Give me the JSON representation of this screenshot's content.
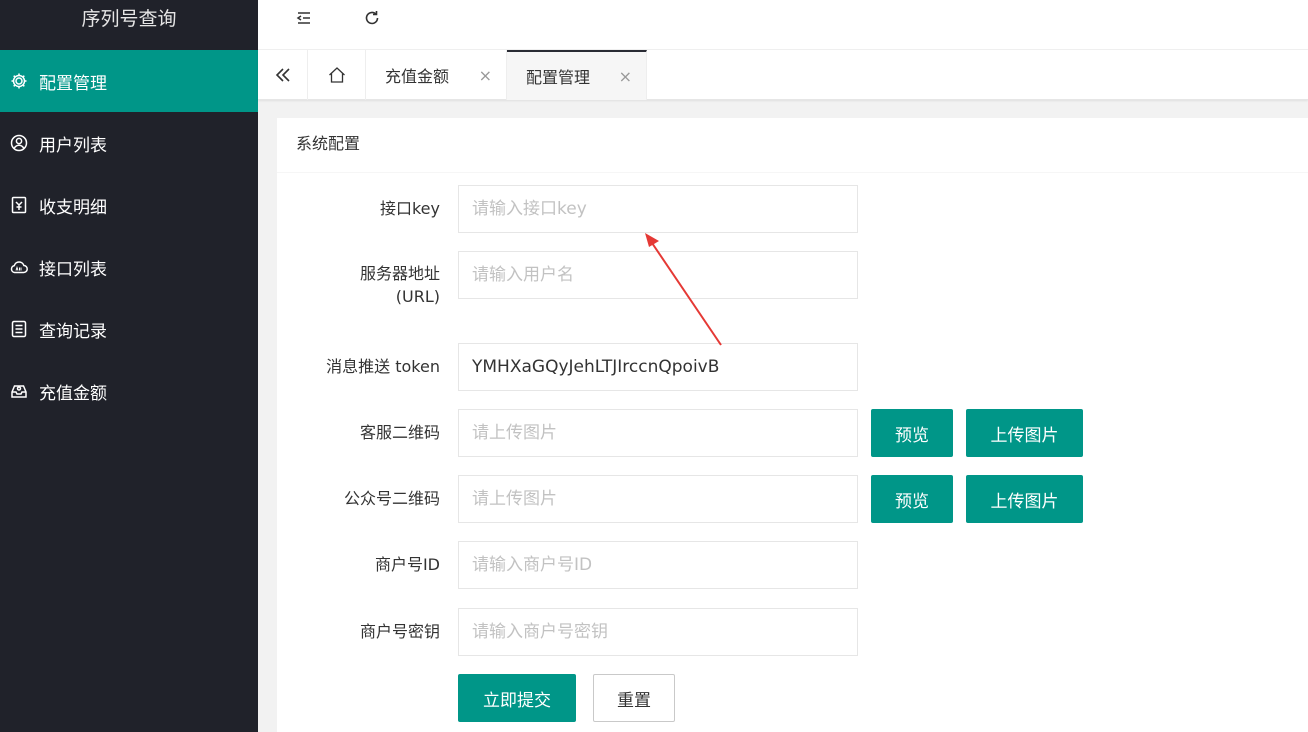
{
  "app": {
    "title": "序列号查询"
  },
  "sidebar": {
    "items": [
      {
        "label": "配置管理",
        "icon": "gear-icon",
        "active": true
      },
      {
        "label": "用户列表",
        "icon": "user-icon",
        "active": false
      },
      {
        "label": "收支明细",
        "icon": "ledger-icon",
        "active": false
      },
      {
        "label": "接口列表",
        "icon": "cloud-api-icon",
        "active": false
      },
      {
        "label": "查询记录",
        "icon": "list-icon",
        "active": false
      },
      {
        "label": "充值金额",
        "icon": "tray-icon",
        "active": false
      }
    ]
  },
  "header": {
    "menu_toggle_icon": "menu-fold-icon",
    "refresh_icon": "refresh-icon"
  },
  "tabs": {
    "controls": {
      "collapse_icon": "double-chevron-left-icon",
      "home_icon": "home-icon"
    },
    "items": [
      {
        "label": "充值金额",
        "active": false,
        "close": "×"
      },
      {
        "label": "配置管理",
        "active": true,
        "close": "×"
      }
    ]
  },
  "form": {
    "title": "系统配置",
    "fields": {
      "api_key": {
        "label": "接口key",
        "value": "",
        "placeholder": "请输入接口key"
      },
      "server_url": {
        "label_line1": "服务器地址",
        "label_line2": "(URL)",
        "value": "",
        "placeholder": "请输入用户名"
      },
      "push_token": {
        "label": "消息推送 token",
        "value": "YMHXaGQyJehLTJIrccnQpoivB",
        "placeholder": ""
      },
      "service_qr": {
        "label": "客服二维码",
        "value": "",
        "placeholder": "请上传图片",
        "preview": "预览",
        "upload": "上传图片"
      },
      "official_qr": {
        "label": "公众号二维码",
        "value": "",
        "placeholder": "请上传图片",
        "preview": "预览",
        "upload": "上传图片"
      },
      "merchant_id": {
        "label": "商户号ID",
        "value": "",
        "placeholder": "请输入商户号ID"
      },
      "merchant_secret": {
        "label": "商户号密钥",
        "value": "",
        "placeholder": "请输入商户号密钥"
      }
    },
    "submit": "立即提交",
    "reset": "重置"
  },
  "colors": {
    "accent": "#009688",
    "sidebar_bg": "#20222a",
    "annotation": "#e53935"
  }
}
